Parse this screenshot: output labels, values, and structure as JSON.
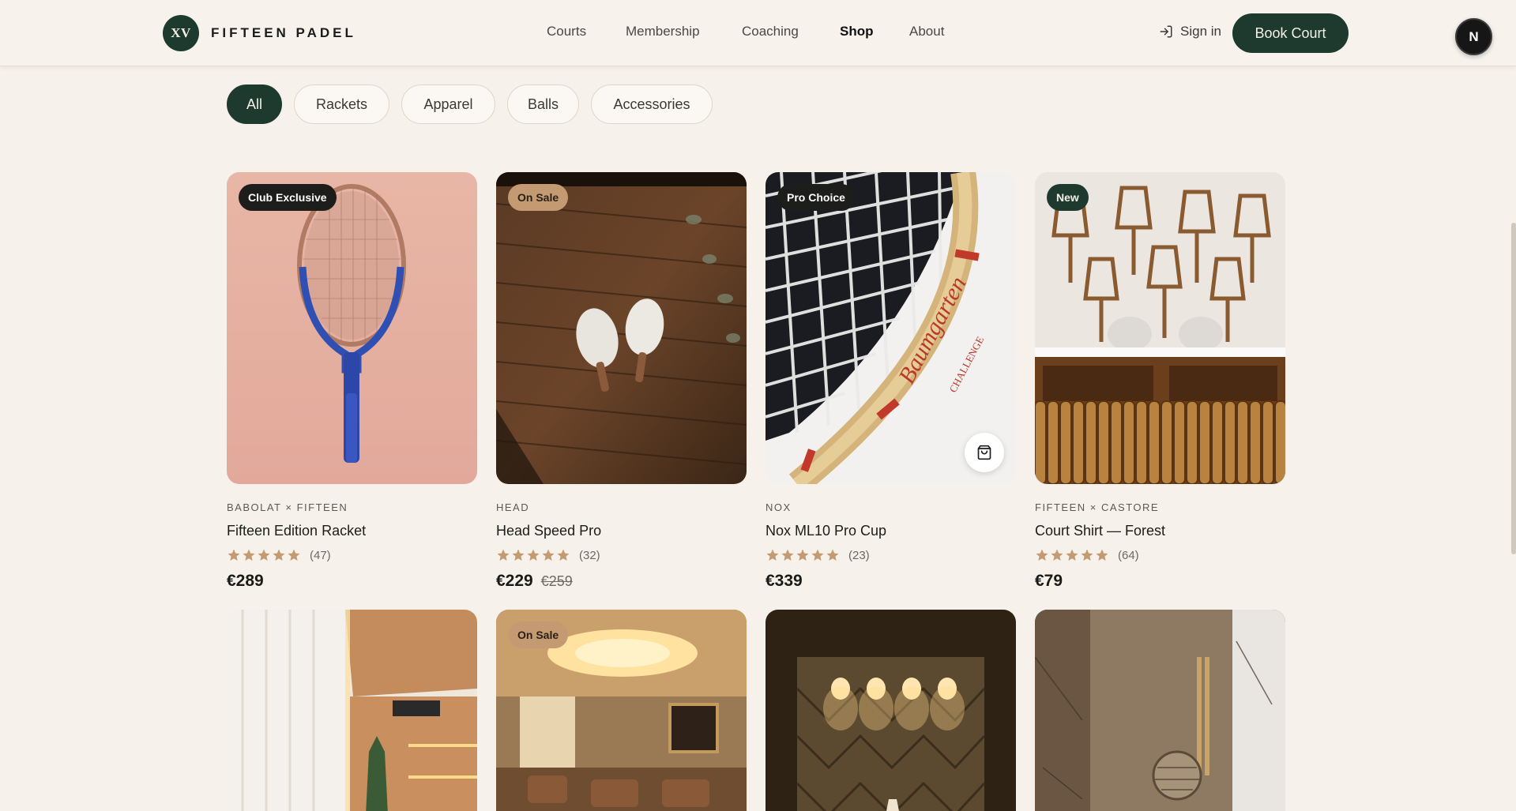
{
  "brand": {
    "mark": "XV",
    "name": "FIFTEEN PADEL"
  },
  "nav": {
    "links": [
      "Courts",
      "Membership",
      "Coaching",
      "Shop",
      "About"
    ],
    "active": "Shop",
    "sign_in": "Sign in",
    "book_court": "Book Court",
    "avatar_letter": "N"
  },
  "filters": {
    "chips": [
      "All",
      "Rackets",
      "Apparel",
      "Balls",
      "Accessories"
    ],
    "active": "All"
  },
  "products": [
    {
      "badge": "Club Exclusive",
      "brand": "BABOLAT × FIFTEEN",
      "name": "Fifteen Edition Racket",
      "rating": 5,
      "reviews": "(47)",
      "price": "€289",
      "old_price": ""
    },
    {
      "badge": "On Sale",
      "brand": "HEAD",
      "name": "Head Speed Pro",
      "rating": 5,
      "reviews": "(32)",
      "price": "€229",
      "old_price": "€259"
    },
    {
      "badge": "Pro Choice",
      "brand": "NOX",
      "name": "Nox ML10 Pro Cup",
      "rating": 5,
      "reviews": "(23)",
      "price": "€339",
      "old_price": ""
    },
    {
      "badge": "New",
      "brand": "FIFTEEN × CASTORE",
      "name": "Court Shirt — Forest",
      "rating": 5,
      "reviews": "(64)",
      "price": "€79",
      "old_price": ""
    }
  ],
  "row2": [
    {
      "badge": ""
    },
    {
      "badge": "On Sale"
    },
    {
      "badge": ""
    },
    {
      "badge": ""
    }
  ],
  "colors": {
    "primary": "#1e3a2f",
    "background": "#f6f1ea",
    "star": "#c49a72",
    "badge_sale": "#c49a72"
  }
}
